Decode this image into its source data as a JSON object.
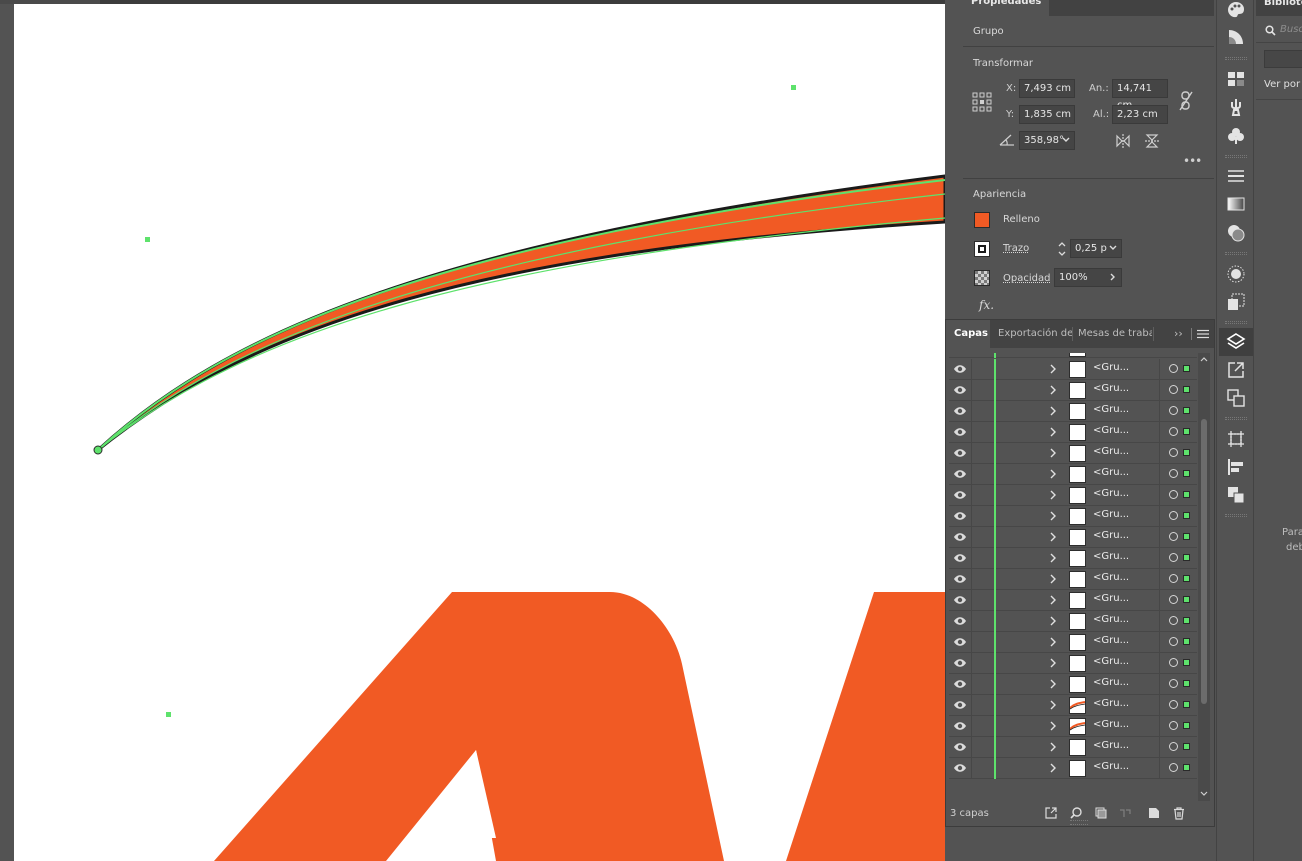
{
  "colors": {
    "accent_orange": "#f15a24",
    "selection_green": "#5ee26c",
    "panel_bg": "#535353",
    "panel_dark": "#434343"
  },
  "properties": {
    "tab_label": "Propiedades",
    "object_type": "Grupo",
    "transform": {
      "title": "Transformar",
      "x_label": "X:",
      "x_value": "7,493 cm",
      "y_label": "Y:",
      "y_value": "1,835 cm",
      "w_label": "An.:",
      "w_value": "14,741 cm",
      "h_label": "Al.:",
      "h_value": "2,23 cm",
      "angle_value": "358,98°",
      "more": "•••"
    },
    "appearance": {
      "title": "Apariencia",
      "fill_label": "Relleno",
      "stroke_label": "Trazo",
      "stroke_value": "0,25 p",
      "opacity_label": "Opacidad",
      "opacity_value": "100%",
      "fx_label": "fx."
    }
  },
  "libraries": {
    "title": "Bibliotecas",
    "search_placeholder": "Buscar",
    "view_label": "Ver por",
    "message_line1": "Para",
    "message_line2": "deb"
  },
  "layers_panel": {
    "tabs": [
      "Capas",
      "Exportación de",
      "Mesas de trabaj"
    ],
    "overflow": "››",
    "layer_count": "3 capas",
    "rows": [
      {
        "name": "<Gru...",
        "thumb": "blank"
      },
      {
        "name": "<Gru...",
        "thumb": "blank"
      },
      {
        "name": "<Gru...",
        "thumb": "blank"
      },
      {
        "name": "<Gru...",
        "thumb": "blank"
      },
      {
        "name": "<Gru...",
        "thumb": "blank"
      },
      {
        "name": "<Gru...",
        "thumb": "blank"
      },
      {
        "name": "<Gru...",
        "thumb": "blank"
      },
      {
        "name": "<Gru...",
        "thumb": "blank"
      },
      {
        "name": "<Gru...",
        "thumb": "blank"
      },
      {
        "name": "<Gru...",
        "thumb": "blank"
      },
      {
        "name": "<Gru...",
        "thumb": "blank"
      },
      {
        "name": "<Gru...",
        "thumb": "blank"
      },
      {
        "name": "<Gru...",
        "thumb": "blank"
      },
      {
        "name": "<Gru...",
        "thumb": "blank"
      },
      {
        "name": "<Gru...",
        "thumb": "blank"
      },
      {
        "name": "<Gru...",
        "thumb": "blank"
      },
      {
        "name": "<Gru...",
        "thumb": "curve"
      },
      {
        "name": "<Gru...",
        "thumb": "curve"
      },
      {
        "name": "<Gru...",
        "thumb": "blank"
      },
      {
        "name": "<Gru...",
        "thumb": "blank"
      }
    ]
  }
}
